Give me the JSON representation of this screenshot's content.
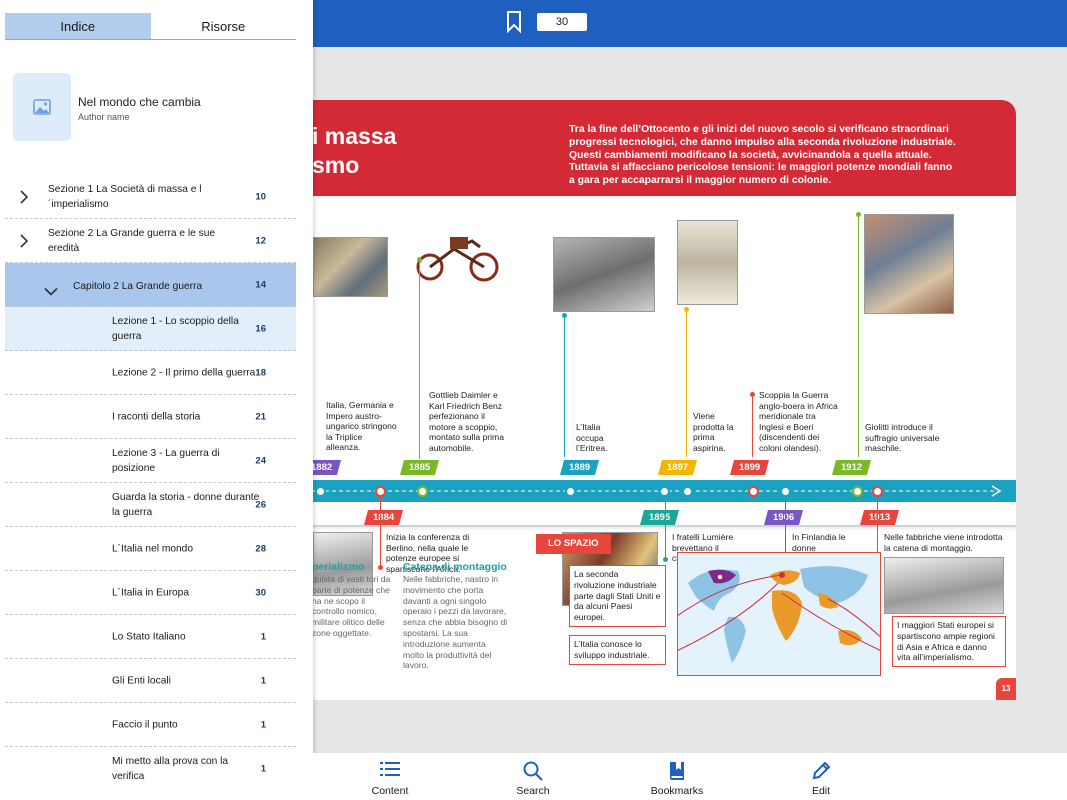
{
  "reader": {
    "current_page": "30"
  },
  "sidebar": {
    "tabs": [
      "Indice",
      "Risorse"
    ],
    "book": {
      "title": "Nel mondo che cambia",
      "author": "Author name"
    },
    "toc": [
      {
        "label": "Sezione 1 La Società di massa e l´imperialismo",
        "page": "10"
      },
      {
        "label": "Sezione 2 La Grande guerra e le sue eredità",
        "page": "12"
      },
      {
        "label": "Capitolo 2 La Grande guerra",
        "page": "14"
      },
      {
        "label": "Lezione 1 - Lo scoppio della guerra",
        "page": "16"
      },
      {
        "label": "Lezione 2 - Il primo della guerra",
        "page": "18"
      },
      {
        "label": "I raconti della storia",
        "page": "21"
      },
      {
        "label": "Lezione 3 - La guerra di posizione",
        "page": "24"
      },
      {
        "label": "Guarda la storia - donne durante la guerra",
        "page": "26"
      },
      {
        "label": "L´Italia nel mondo",
        "page": "28"
      },
      {
        "label": "L´Italia in Europa",
        "page": "30"
      },
      {
        "label": "Lo Stato Italiano",
        "page": "1"
      },
      {
        "label": "Gli Enti locali",
        "page": "1"
      },
      {
        "label": "Faccio il punto",
        "page": "1"
      },
      {
        "label": "Mi metto alla prova con la verifica",
        "page": "1"
      }
    ]
  },
  "book_page": {
    "title_line1": "i massa",
    "title_line2": "smo",
    "intro": "Tra la fine dell’Ottocento e gli inizi del nuovo secolo si verificano straordinari progressi tecnologici, che danno impulso alla seconda rivoluzione industriale. Questi cambiamenti modificano la società, avvicinandola a quella attuale. Tuttavia si affacciano pericolose tensioni: le maggiori potenze mondiali fanno a gara per accaparrarsi il maggior numero di colonie.",
    "years_top": [
      "1882",
      "1885",
      "1889",
      "1897",
      "1899",
      "1912"
    ],
    "years_bottom": [
      "1884",
      "1895",
      "1906",
      "1913"
    ],
    "events_top": [
      "Italia, Germania e Impero austro-ungarico stringono la Triplice alleanza.",
      "Gottlieb Daimler e Karl Friedrich Benz perfezionano il motore a scoppio, montato sulla prima automobile.",
      "L’Italia occupa l’Eritrea.",
      "Viene prodotta la prima aspirina.",
      "Scoppia la Guerra anglo-boera in Africa meridionale tra Inglesi e Boeri (discendenti dei coloni olandesi).",
      "Giolitti introduce il suffragio universale maschile."
    ],
    "events_bottom": [
      "Inizia la conferenza di Berlino, nella quale le potenze europee si spartiscono l’Africa.",
      "I fratelli Lumière brevettano il cinematografo.",
      "In Finlandia le donne ottengono il diritto di voto.",
      "Nelle fabbriche viene introdotta la catena di montaggio."
    ],
    "space_tag": "LO SPAZIO",
    "imperialismo_head": "perialismo",
    "imperialismo_text": "quista di vasti tori da parte di potenze che ha ne scopo il controllo nomico, militare olitico delle zone oggettate.",
    "catena_head": "Catena di montaggio",
    "catena_text": "Nelle fabbriche, nastro in movimento che porta davanti a ogni singolo operaio i pezzi da lavorare, senza che abbia bisogno di spostarsi. La sua introduzione aumenta molto la produttività del lavoro.",
    "map_labels": [
      "La seconda rivoluzione industriale parte dagli Stati Uniti e da alcuni Paesi europei.",
      "L’Italia conosce lo sviluppo industriale.",
      "I maggiori Stati europei si spartiscono ampie regioni di Asia e Africa e danno vita all’imperialismo."
    ],
    "page_number": "13"
  },
  "bottom_nav": [
    "Content",
    "Search",
    "Bookmarks",
    "Edit"
  ],
  "colors": {
    "topbar": "#1f5fbf",
    "header_red": "#d42a36",
    "timeline_band": "#1aa2c0",
    "sidebar_tab_active": "#b3cdef",
    "chapter_row": "#a9c7ec",
    "current_row": "#e3eefb"
  }
}
